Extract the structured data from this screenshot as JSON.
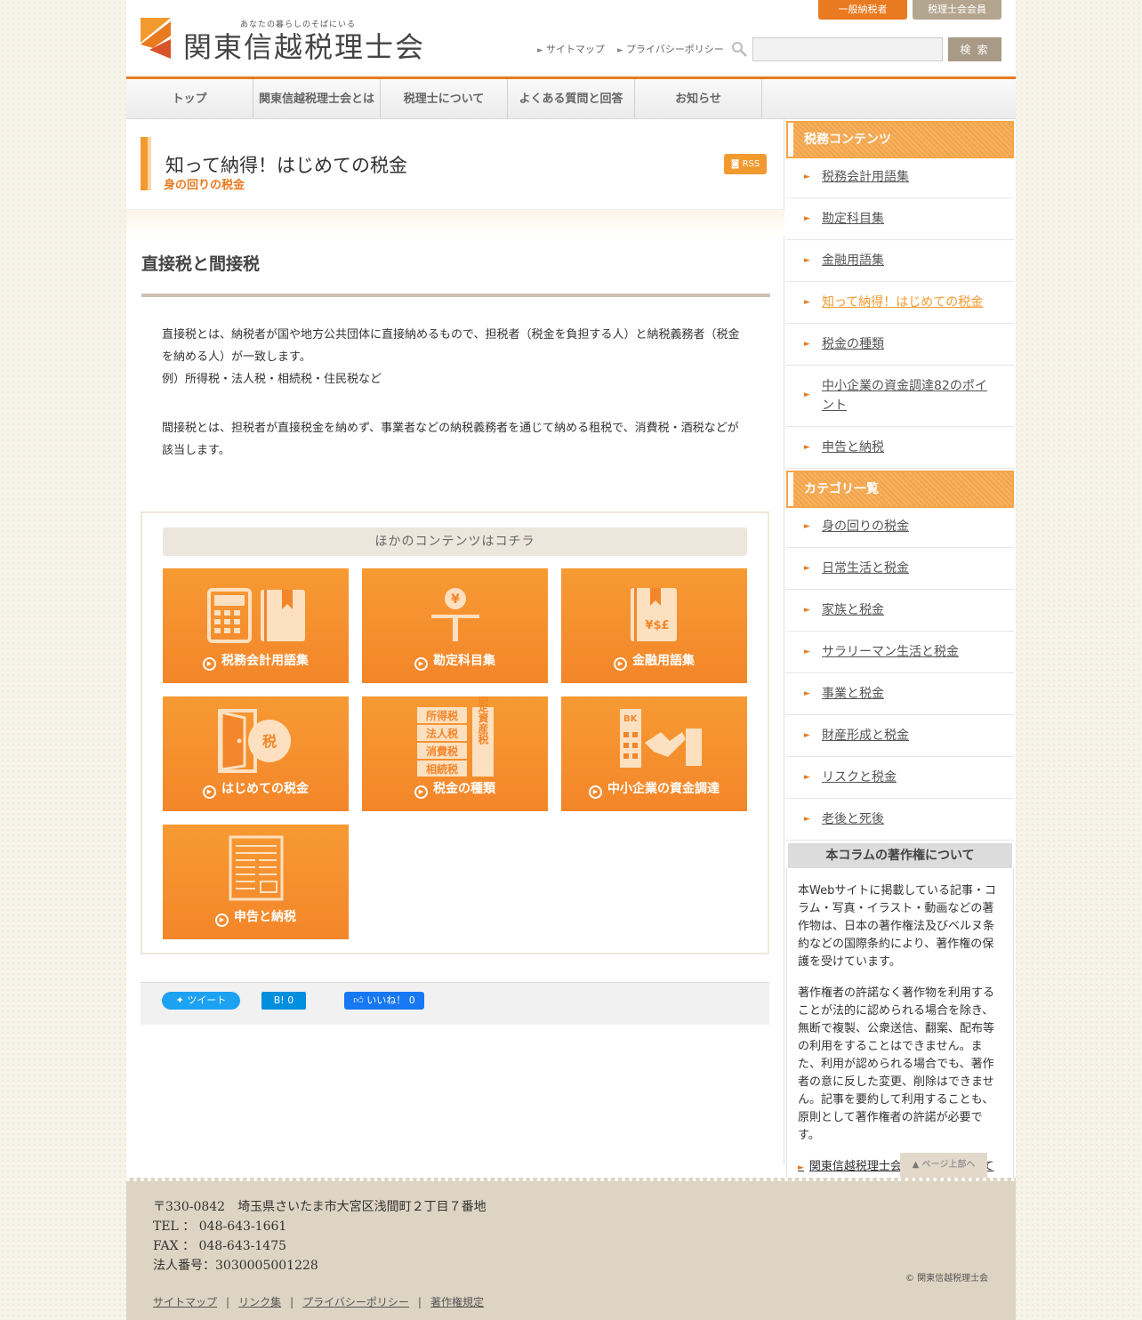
{
  "header": {
    "tagline": "あなたの暮らしのそばにいる",
    "logo_text": "関東信越税理士会",
    "btn_general": "一般納税者",
    "btn_member": "税理士会会員",
    "link_sitemap": "サイトマップ",
    "link_privacy": "プライバシーポリシー",
    "search_placeholder": "",
    "search_button": "検 索",
    "accent_color": "#e97a1f"
  },
  "nav": {
    "items": [
      {
        "label": "トップ"
      },
      {
        "label": "関東信越税理士会とは"
      },
      {
        "label": "税理士について"
      },
      {
        "label": "よくある質問と回答"
      },
      {
        "label": "お知らせ"
      }
    ]
  },
  "page": {
    "title": "知って納得！はじめての税金",
    "subtitle": "身の回りの税金",
    "rss": "RSS"
  },
  "article": {
    "title": "直接税と間接税",
    "para1_line1": "直接税とは、納税者が国や地方公共団体に直接納めるもので、担税者（税金を負担する人）と納税義務者（税金を納める人）が一致します。",
    "para1_line2": "例）所得税・法人税・相続税・住民税など",
    "para2": "間接税とは、担税者が直接税金を納めず、事業者などの納税義務者を通じて納める租税で、消費税・酒税などが該当します。"
  },
  "others": {
    "title": "ほかのコンテンツはコチラ",
    "tiles": [
      {
        "label": "税務会計用語集",
        "icon": "calculator-book-icon"
      },
      {
        "label": "勘定科目集",
        "icon": "yen-sign-icon"
      },
      {
        "label": "金融用語集",
        "icon": "currency-book-icon"
      },
      {
        "label": "はじめての税金",
        "icon": "door-tax-icon",
        "badge": "税"
      },
      {
        "label": "税金の種類",
        "icon": "tax-types-icon",
        "words": [
          "所得税",
          "法人税",
          "消費税",
          "相続税",
          "固定資産税"
        ]
      },
      {
        "label": "中小企業の資金調達",
        "icon": "bank-handshake-icon",
        "bank": "BK"
      },
      {
        "label": "申告と納税",
        "icon": "form-document-icon"
      }
    ]
  },
  "social": {
    "tweet": "ツイート",
    "hatena": "B! 0",
    "like": "いいね！ 0"
  },
  "sidebar": {
    "tax_heading": "税務コンテンツ",
    "tax_items": [
      {
        "label": "税務会計用語集"
      },
      {
        "label": "勘定科目集"
      },
      {
        "label": "金融用語集"
      },
      {
        "label": "知って納得！はじめての税金"
      },
      {
        "label": "税金の種類"
      },
      {
        "label": "中小企業の資金調達82のポイント"
      },
      {
        "label": "申告と納税"
      }
    ],
    "cat_heading": "カテゴリ一覧",
    "cat_items": [
      {
        "label": "身の回りの税金"
      },
      {
        "label": "日常生活と税金"
      },
      {
        "label": "家族と税金"
      },
      {
        "label": "サラリーマン生活と税金"
      },
      {
        "label": "事業と税金"
      },
      {
        "label": "財産形成と税金"
      },
      {
        "label": "リスクと税金"
      },
      {
        "label": "老後と死後"
      }
    ],
    "copyright_heading": "本コラムの著作権について",
    "copyright_p1": "本Webサイトに掲載している記事・コラム・写真・イラスト・動画などの著作物は、日本の著作権法及びベルヌ条約などの国際条約により、著作権の保護を受けています。",
    "copyright_p2": "著作権者の許諾なく著作物を利用することが法的に認められる場合を除き、無断で複製、公衆送信、翻案、配布等の利用をすることはできません。また、利用が認められる場合でも、著作者の意に反した変更、削除はできません。記事を要約して利用することも、原則として著作権者の許諾が必要です。",
    "copyright_link": "関東信越税理士会の著作権について"
  },
  "footer": {
    "pagetop": "▲ ページ上部へ",
    "address": "〒330-0842　埼玉県さいたま市大宮区浅間町２丁目７番地",
    "tel": "TEL ： 048-643-1661",
    "fax": "FAX ： 048-643-1475",
    "corp_no": "法人番号：3030005001228",
    "links": [
      "サイトマップ",
      "リンク集",
      "プライバシーポリシー",
      "著作権規定"
    ],
    "copyright": "© 関東信越税理士会"
  }
}
